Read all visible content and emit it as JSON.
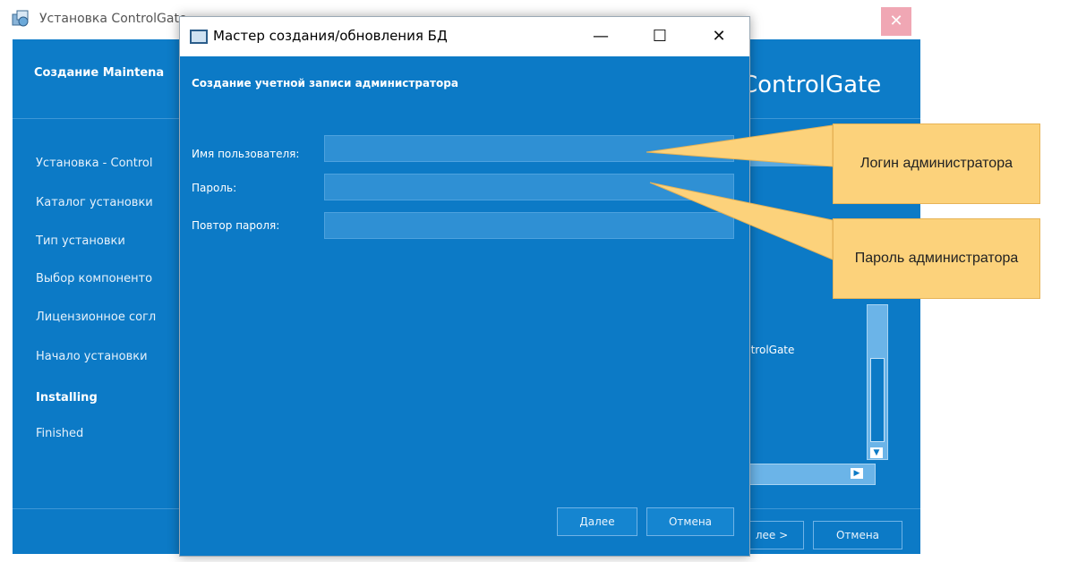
{
  "background_window": {
    "title": "Установка ControlGate",
    "header_title": "Создание Maintena",
    "brand": "ControlGate",
    "close_symbol": "✕",
    "steps": [
      {
        "label": "Установка - Control",
        "bold": false
      },
      {
        "label": "Каталог установки",
        "bold": false
      },
      {
        "label": "Тип установки",
        "bold": false
      },
      {
        "label": "Выбор компоненто",
        "bold": false
      },
      {
        "label": "Лицензионное согл",
        "bold": false
      },
      {
        "label": "Начало установки",
        "bold": false
      },
      {
        "label": "Installing",
        "bold": true
      },
      {
        "label": "Finished",
        "bold": false
      }
    ],
    "content_text": "ntrolGate",
    "next_button": "лее >",
    "cancel_button": "Отмена",
    "scroll_down_symbol": "▼",
    "scroll_right_symbol": "▶"
  },
  "dialog": {
    "title": "Мастер создания/обновления БД",
    "minimize_symbol": "—",
    "maximize_symbol": "☐",
    "close_symbol": "✕",
    "heading": "Создание учетной записи администратора",
    "fields": [
      {
        "label": "Имя пользователя:",
        "value": ""
      },
      {
        "label": "Пароль:",
        "value": ""
      },
      {
        "label": "Повтор пароля:",
        "value": ""
      }
    ],
    "next_button": "Далее",
    "cancel_button": "Отмена"
  },
  "callouts": {
    "login": "Логин администратора",
    "password": "Пароль администратора"
  },
  "colors": {
    "window_blue": "#0c7ac6",
    "callout_fill": "#fcd27b",
    "close_pink": "#f0a7b4"
  }
}
